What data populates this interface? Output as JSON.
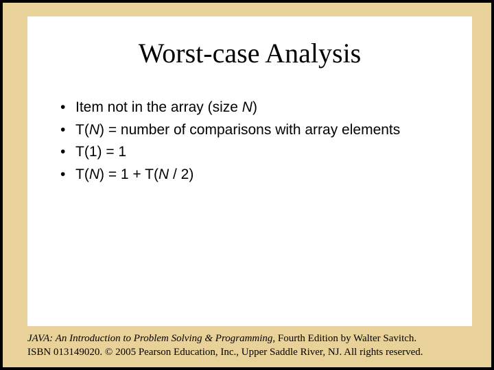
{
  "slide": {
    "title": "Worst-case Analysis",
    "bullets": [
      {
        "pre": "Item not in the array (size ",
        "ital": "N",
        "post": ")"
      },
      {
        "pre": "T(",
        "ital": "N",
        "post": ") = number of comparisons with array elements"
      },
      {
        "pre": "T(1) = 1",
        "ital": "",
        "post": ""
      },
      {
        "pre": "T(",
        "ital": "N",
        "mid": ") = 1 + T(",
        "ital2": "N",
        "post": " / 2)"
      }
    ]
  },
  "footer": {
    "book_title": "JAVA: An Introduction to Problem Solving & Programming",
    "edition": ", Fourth Edition by Walter Savitch.",
    "copyright": "ISBN 013149020. © 2005 Pearson Education, Inc., Upper Saddle River, NJ. All rights reserved."
  },
  "glyphs": {
    "bullet": "•"
  }
}
